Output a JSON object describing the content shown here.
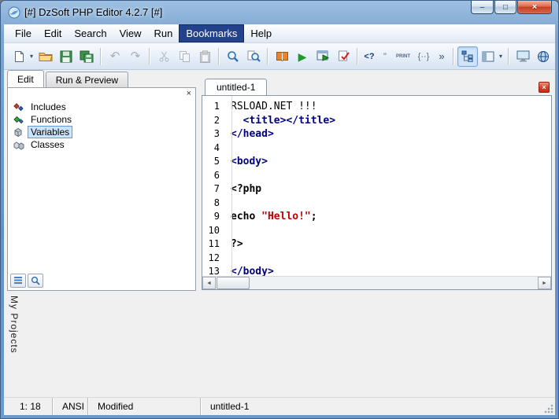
{
  "window": {
    "title": "[#] DzSoft PHP Editor 4.2.7 [#]",
    "minimize_glyph": "–",
    "maximize_glyph": "□",
    "close_glyph": "×"
  },
  "menu": {
    "items": [
      {
        "label": "File"
      },
      {
        "label": "Edit"
      },
      {
        "label": "Search"
      },
      {
        "label": "View"
      },
      {
        "label": "Run"
      },
      {
        "label": "Bookmarks",
        "highlighted": true
      },
      {
        "label": "Help"
      }
    ]
  },
  "toolbar": {
    "dropdown_glyph": "▾",
    "undo_glyph": "↶",
    "redo_glyph": "↷",
    "run_glyph": "▶",
    "php_glyph": "<?",
    "quote_glyph": "\"",
    "print_glyph": "PRINT",
    "braces_glyph": "{··}",
    "chevron_glyph": "»"
  },
  "page_tabs": {
    "edit": "Edit",
    "run_preview": "Run & Preview"
  },
  "explorer": {
    "close_glyph": "×",
    "items": [
      {
        "label": "Includes"
      },
      {
        "label": "Functions"
      },
      {
        "label": "Variables",
        "selected": true
      },
      {
        "label": "Classes"
      }
    ]
  },
  "editor": {
    "tab": "untitled-1",
    "close_glyph": "×",
    "scroll_left_glyph": "◄",
    "scroll_right_glyph": "►",
    "lines": [
      {
        "n": "1",
        "s0": "RSLOAD.NET !!!"
      },
      {
        "n": "2",
        "s0": "  <title></title>"
      },
      {
        "n": "3",
        "s0": "</head>"
      },
      {
        "n": "4"
      },
      {
        "n": "5",
        "s0": "<body>"
      },
      {
        "n": "6"
      },
      {
        "n": "7",
        "s0": "<?php"
      },
      {
        "n": "8"
      },
      {
        "n": "9",
        "s0": "echo ",
        "s1": "\"Hello!\"",
        "s2": ";"
      },
      {
        "n": "10"
      },
      {
        "n": "11",
        "s0": "?>"
      },
      {
        "n": "12"
      },
      {
        "n": "13",
        "s0": "</body>"
      }
    ]
  },
  "projects": {
    "label": "My Projects"
  },
  "status": {
    "cursor": "1: 18",
    "encoding": "ANSI",
    "state": "Modified",
    "file": "untitled-1"
  }
}
